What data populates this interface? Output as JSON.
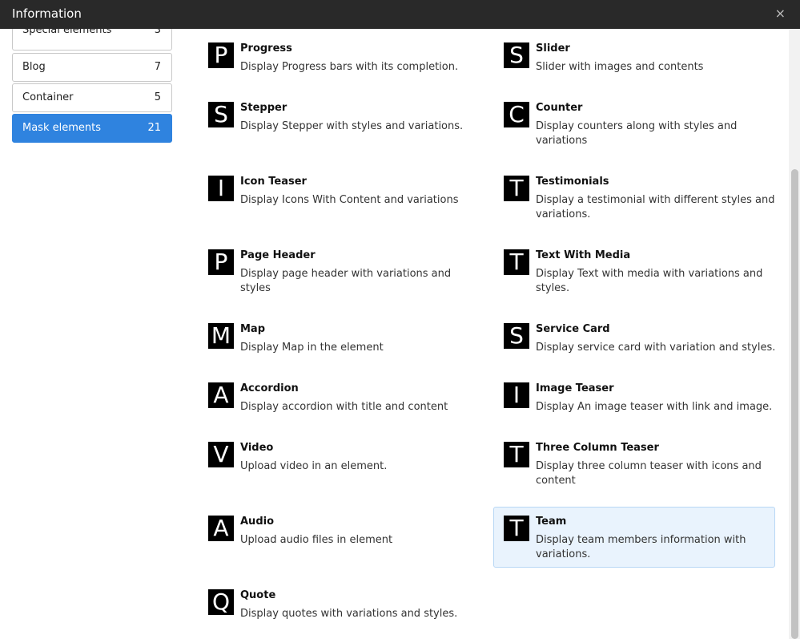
{
  "window": {
    "title": "Information",
    "close_glyph": "×"
  },
  "sidebar": {
    "items": [
      {
        "label": "Special elements",
        "count": "3"
      },
      {
        "label": "Blog",
        "count": "7"
      },
      {
        "label": "Container",
        "count": "5"
      },
      {
        "label": "Mask elements",
        "count": "21",
        "active": true
      }
    ]
  },
  "elements": [
    {
      "glyph": "P",
      "name": "Progress",
      "desc": "Display Progress bars with its completion."
    },
    {
      "glyph": "S",
      "name": "Slider",
      "desc": "Slider with images and contents"
    },
    {
      "glyph": "S",
      "name": "Stepper",
      "desc": "Display Stepper with styles and variations."
    },
    {
      "glyph": "C",
      "name": "Counter",
      "desc": "Display counters along with styles and variations"
    },
    {
      "glyph": "I",
      "name": "Icon Teaser",
      "desc": "Display Icons With Content and variations"
    },
    {
      "glyph": "T",
      "name": "Testimonials",
      "desc": "Display a testimonial with different styles and variations."
    },
    {
      "glyph": "P",
      "name": "Page Header",
      "desc": "Display page header with variations and styles"
    },
    {
      "glyph": "T",
      "name": "Text With Media",
      "desc": "Display Text with media with variations and styles."
    },
    {
      "glyph": "M",
      "name": "Map",
      "desc": "Display Map in the element"
    },
    {
      "glyph": "S",
      "name": "Service Card",
      "desc": "Display service card with variation and styles."
    },
    {
      "glyph": "A",
      "name": "Accordion",
      "desc": "Display accordion with title and content"
    },
    {
      "glyph": "I",
      "name": "Image Teaser",
      "desc": "Display An image teaser with link and image."
    },
    {
      "glyph": "V",
      "name": "Video",
      "desc": "Upload video in an element."
    },
    {
      "glyph": "T",
      "name": "Three Column Teaser",
      "desc": "Display three column teaser with icons and content"
    },
    {
      "glyph": "A",
      "name": "Audio",
      "desc": "Upload audio files in element"
    },
    {
      "glyph": "T",
      "name": "Team",
      "desc": "Display team members information with variations.",
      "highlighted": true
    },
    {
      "glyph": "Q",
      "name": "Quote",
      "desc": "Display quotes with variations and styles."
    }
  ],
  "colors": {
    "titlebar": "#292929",
    "accent": "#2f83df",
    "highlight_bg": "#e9f3fd"
  }
}
